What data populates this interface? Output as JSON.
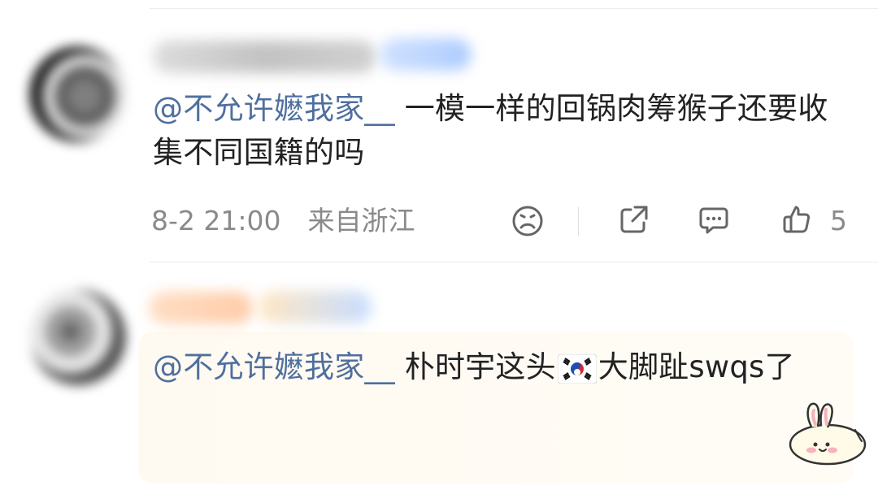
{
  "comments": [
    {
      "mention": "@不允许嬷我家__",
      "body": " 一模一样的回锅肉筹猴子还要收集不同国籍的吗",
      "timestamp": "8-2 21:00",
      "location": "来自浙江",
      "likes": "5",
      "icons": [
        "frown-icon",
        "share-icon",
        "reply-icon",
        "thumbs-up-icon"
      ]
    },
    {
      "mention": "@不允许嬷我家__",
      "body_before_flag": " 朴时宇这头",
      "body_after_flag": "大脚趾swqs了",
      "flag_icon": "south-korea-flag-icon",
      "sticker": "bunny-sticker"
    }
  ],
  "colors": {
    "mention": "#4f6f9f",
    "meta_text": "#8a8a8a",
    "divider": "#ececec",
    "comment_text": "#222222",
    "sticker_bg": "#fff8eb"
  }
}
